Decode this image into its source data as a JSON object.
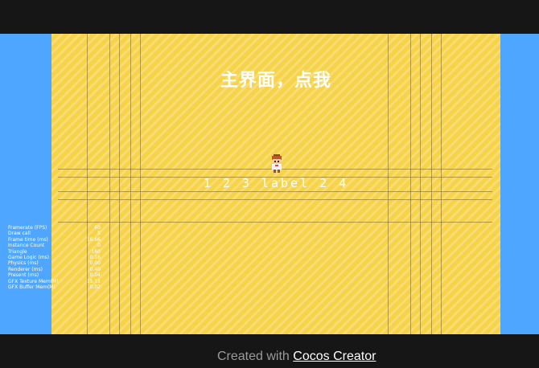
{
  "game": {
    "title": "主界面，点我",
    "number_label": "1 2 3 label 2 4",
    "character_icon": "pixel-character-icon"
  },
  "stats": [
    {
      "label": "Framerate (FPS)",
      "value": "60"
    },
    {
      "label": "Draw call",
      "value": "5"
    },
    {
      "label": "Frame time (ms)",
      "value": "16.66"
    },
    {
      "label": "Instance Count",
      "value": "0"
    },
    {
      "label": "Triangle",
      "value": "160"
    },
    {
      "label": "Game Logic (ms)",
      "value": "0.16"
    },
    {
      "label": "Physics (ms)",
      "value": "0.00"
    },
    {
      "label": "Renderer (ms)",
      "value": "0.40"
    },
    {
      "label": "Present (ms)",
      "value": "0.04"
    },
    {
      "label": "GFX Texture Mem(M)",
      "value": "15.11"
    },
    {
      "label": "GFX Buffer Mem(M)",
      "value": "0.02"
    }
  ],
  "footer": {
    "prefix": "Created with ",
    "link_label": "Cocos Creator"
  },
  "colors": {
    "background": "#161616",
    "side_panel": "#4ea6ff",
    "canvas": "#f7d34a"
  }
}
